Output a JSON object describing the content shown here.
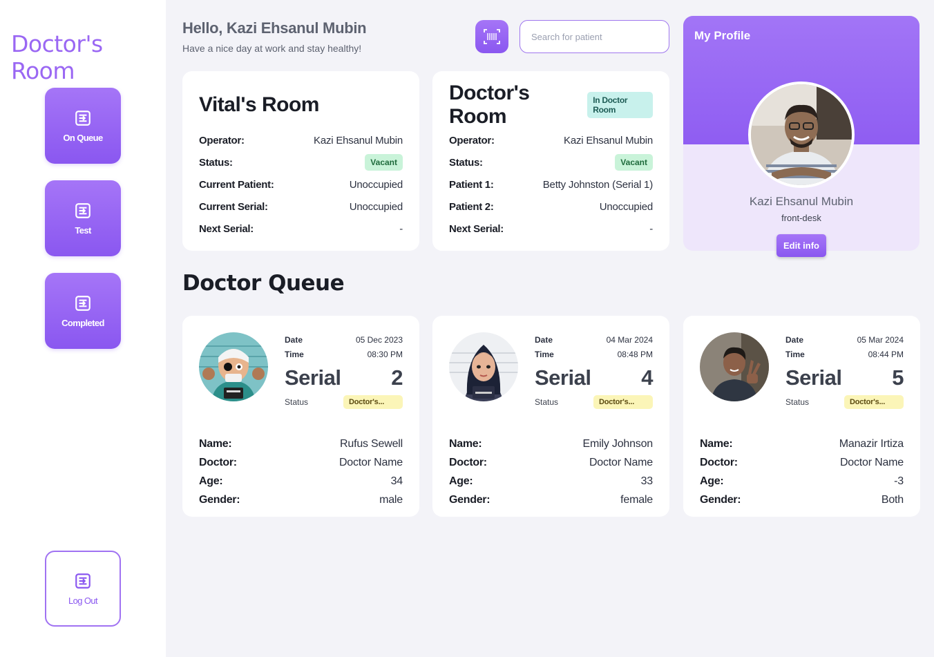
{
  "brand": "Doctor's Room",
  "colors": {
    "accent": "#8a57f0",
    "accent_light": "#a575f7",
    "vacant": "#c9f3d9",
    "in_room": "#c8f1ec",
    "status_chip": "#fbf5b8"
  },
  "nav": {
    "on_queue": "On Queue",
    "test": "Test",
    "completed": "Completed",
    "logout": "Log Out"
  },
  "header": {
    "greeting": "Hello, Kazi Ehsanul Mubin",
    "subtitle": "Have a nice day at work and stay healthy!",
    "search_placeholder": "Search for patient"
  },
  "vitals_room": {
    "title": "Vital's Room",
    "rows": [
      {
        "label": "Operator:",
        "value": "Kazi Ehsanul Mubin"
      },
      {
        "label": "Status:",
        "value": "Vacant"
      },
      {
        "label": "Current Patient:",
        "value": "Unoccupied"
      },
      {
        "label": "Current Serial:",
        "value": "Unoccupied"
      },
      {
        "label": "Next Serial:",
        "value": "-"
      }
    ]
  },
  "doctors_room": {
    "title": "Doctor's Room",
    "tag": "In Doctor Room",
    "rows": [
      {
        "label": "Operator:",
        "value": "Kazi Ehsanul Mubin"
      },
      {
        "label": "Status:",
        "value": "Vacant"
      },
      {
        "label": "Patient 1:",
        "value": "Betty Johnston (Serial 1)"
      },
      {
        "label": "Patient 2:",
        "value": "Unoccupied"
      },
      {
        "label": "Next Serial:",
        "value": "-"
      }
    ]
  },
  "profile": {
    "title": "My Profile",
    "name": "Kazi Ehsanul Mubin",
    "role": "front-desk",
    "edit_label": "Edit info"
  },
  "queue": {
    "title": "Doctor Queue",
    "labels": {
      "date": "Date",
      "time": "Time",
      "serial": "Serial",
      "status": "Status",
      "name": "Name:",
      "doctor": "Doctor:",
      "age": "Age:",
      "gender": "Gender:"
    },
    "cards": [
      {
        "date": "05 Dec 2023",
        "time": "08:30 PM",
        "serial": "2",
        "status": "Doctor's...",
        "name": "Rufus Sewell",
        "doctor": "Doctor Name",
        "age": "34",
        "gender": "male"
      },
      {
        "date": "04 Mar 2024",
        "time": "08:48 PM",
        "serial": "4",
        "status": "Doctor's...",
        "name": "Emily Johnson",
        "doctor": "Doctor Name",
        "age": "33",
        "gender": "female"
      },
      {
        "date": "05 Mar 2024",
        "time": "08:44 PM",
        "serial": "5",
        "status": "Doctor's...",
        "name": "Manazir Irtiza",
        "doctor": "Doctor Name",
        "age": "-3",
        "gender": "Both"
      }
    ]
  }
}
